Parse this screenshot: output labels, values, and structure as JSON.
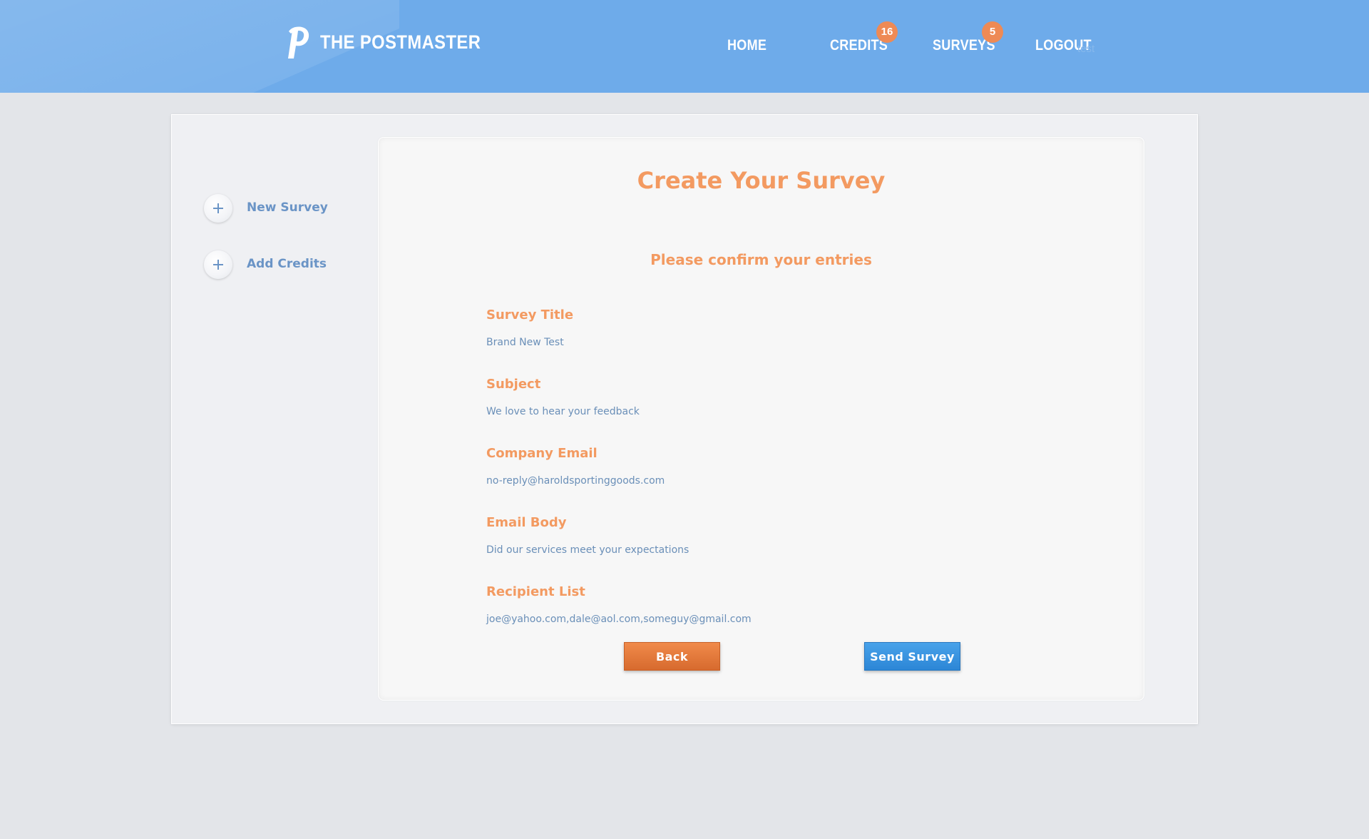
{
  "header": {
    "logo_letter": "p",
    "brand": "THE POSTMASTER",
    "nav": {
      "home": "HOME",
      "credits": "CREDITS",
      "credits_badge": "16",
      "surveys": "SURVEYS",
      "surveys_badge": "5",
      "logout": "LOGOUT",
      "faint_suffix": "test"
    }
  },
  "sidebar": {
    "items": [
      {
        "label": "New Survey",
        "icon": "plus-icon"
      },
      {
        "label": "Add Credits",
        "icon": "plus-icon"
      }
    ]
  },
  "main": {
    "title": "Create Your Survey",
    "subtitle": "Please confirm your entries",
    "fields": [
      {
        "label": "Survey Title",
        "value": "Brand New Test"
      },
      {
        "label": "Subject",
        "value": "We love to hear your feedback"
      },
      {
        "label": "Company Email",
        "value": "no-reply@haroldsportinggoods.com"
      },
      {
        "label": "Email Body",
        "value": "Did our services meet your expectations"
      },
      {
        "label": "Recipient List",
        "value": "joe@yahoo.com,dale@aol.com,someguy@gmail.com"
      }
    ],
    "buttons": {
      "back": "Back",
      "send": "Send Survey"
    }
  },
  "colors": {
    "header_bg": "#6eabea",
    "accent_orange": "#f39a61",
    "badge_orange": "#ee8a55",
    "link_blue": "#6a94c6",
    "send_blue": "#2c86d6",
    "back_orange": "#d76a2e"
  }
}
